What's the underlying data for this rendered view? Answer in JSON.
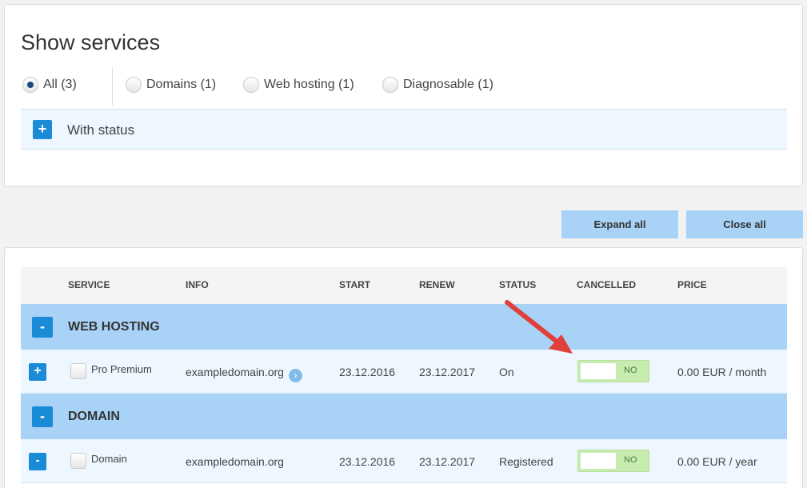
{
  "filters": {
    "title": "Show services",
    "options": [
      {
        "label": "All (3)",
        "checked": true
      },
      {
        "label": "Domains (1)",
        "checked": false
      },
      {
        "label": "Web hosting (1)",
        "checked": false
      },
      {
        "label": "Diagnosable (1)",
        "checked": false
      }
    ],
    "status_label": "With status",
    "status_toggle": "+"
  },
  "toolbar": {
    "expand_label": "Expand all",
    "close_label": "Close all"
  },
  "table": {
    "headers": {
      "service": "SERVICE",
      "info": "INFO",
      "start": "START",
      "renew": "RENEW",
      "status": "STATUS",
      "cancelled": "CANCELLED",
      "price": "PRICE"
    },
    "groups": [
      {
        "toggle": "-",
        "title": "WEB HOSTING",
        "rows": [
          {
            "toggle": "+",
            "service": "Pro Premium",
            "info": "exampledomain.org",
            "info_link_icon": "chevron-right-icon",
            "start": "23.12.2016",
            "renew": "23.12.2017",
            "status": "On",
            "cancelled": "NO",
            "price": "0.00 EUR / month"
          }
        ]
      },
      {
        "toggle": "-",
        "title": "DOMAIN",
        "rows": [
          {
            "toggle": "-",
            "service": "Domain",
            "info": "exampledomain.org",
            "start": "23.12.2016",
            "renew": "23.12.2017",
            "status": "Registered",
            "cancelled": "NO",
            "price": "0.00 EUR / year"
          }
        ]
      }
    ]
  },
  "colors": {
    "accent": "#1a8bd6",
    "group_bg": "#a8d3f6",
    "row_bg": "#eef7ff",
    "toggle_bg": "#c8ecb0",
    "annotation_arrow": "#e0403a"
  }
}
